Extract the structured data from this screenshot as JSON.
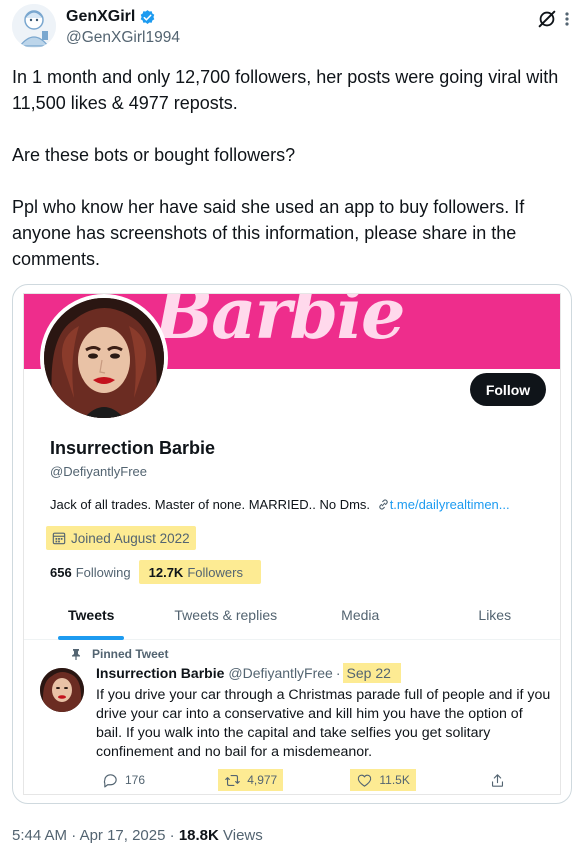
{
  "author": {
    "display_name": "GenXGirl",
    "handle": "@GenXGirl1994"
  },
  "tweet": {
    "paragraphs": [
      "In 1 month and only 12,700 followers, her posts were going viral with 11,500 likes & 4977 reposts.",
      "Are these bots or bought followers?",
      "Ppl who know her have said she used an app to buy followers. If anyone has screenshots of this information, please share in the comments."
    ]
  },
  "embedded_profile": {
    "banner_text": "Barbie",
    "follow_label": "Follow",
    "name": "Insurrection Barbie",
    "handle": "@DefiyantlyFree",
    "bio": "Jack of all trades. Master of none. MARRIED.. No Dms.",
    "bio_link": "t.me/dailyrealtimen...",
    "joined": "Joined August 2022",
    "following_count": "656",
    "following_label": "Following",
    "followers_count": "12.7K",
    "followers_label": "Followers",
    "tabs": [
      "Tweets",
      "Tweets & replies",
      "Media",
      "Likes"
    ],
    "active_tab": "Tweets"
  },
  "pinned_tweet": {
    "pinned_label": "Pinned Tweet",
    "name": "Insurrection Barbie",
    "handle": "@DefiyantlyFree",
    "separator": "·",
    "date": "Sep 22",
    "body": "If you drive your car through a Christmas parade full of people and if you drive your car into a conservative and kill him you have the option of bail. If you walk into the capital and take selfies you get solitary confinement and no bail for a misdemeanor.",
    "replies": "176",
    "retweets": "4,977",
    "likes": "11.5K"
  },
  "footer": {
    "time": "5:44 AM",
    "separator": "·",
    "date": "Apr 17, 2025",
    "views_count": "18.8K",
    "views_label": "Views"
  },
  "colors": {
    "verified_blue": "#1d9bf0",
    "banner_pink": "#ee2d8c",
    "highlight_yellow": "#fdeb93",
    "secondary_text": "#536471"
  },
  "icons": [
    "verified-badge-icon",
    "grok-icon",
    "more-icon",
    "link-icon",
    "calendar-icon",
    "pin-icon",
    "reply-icon",
    "retweet-icon",
    "like-icon",
    "share-icon"
  ]
}
